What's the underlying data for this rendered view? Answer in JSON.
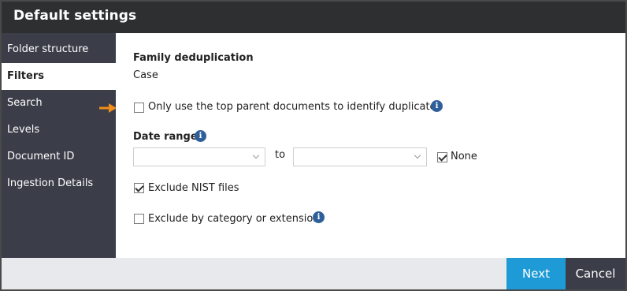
{
  "window": {
    "title": "Default settings"
  },
  "sidebar": {
    "items": [
      {
        "label": "Folder structure"
      },
      {
        "label": "Filters"
      },
      {
        "label": "Search"
      },
      {
        "label": "Levels"
      },
      {
        "label": "Document ID"
      },
      {
        "label": "Ingestion Details"
      }
    ],
    "active_index": 1
  },
  "content": {
    "family_dedup": {
      "heading": "Family deduplication",
      "value": "Case"
    },
    "top_parent": {
      "label": "Only use the top parent documents to identify duplicates",
      "checked": false
    },
    "date_range": {
      "heading": "Date range",
      "from_value": "",
      "to_label": "to",
      "to_value": "",
      "none_label": "None",
      "none_checked": true
    },
    "exclude_nist": {
      "label": "Exclude NIST files",
      "checked": true
    },
    "exclude_category": {
      "label": "Exclude by category or extension",
      "checked": false
    }
  },
  "footer": {
    "next_label": "Next",
    "cancel_label": "Cancel"
  },
  "colors": {
    "titlebar": "#2e2f31",
    "sidebar": "#3b3e49",
    "next_button": "#1e9bd7",
    "arrow": "#f28c1b",
    "info_icon": "#2f5f9a"
  },
  "icons": [
    "info-icon",
    "chevron-down-icon",
    "checkmark-icon",
    "arrow-right-icon"
  ]
}
